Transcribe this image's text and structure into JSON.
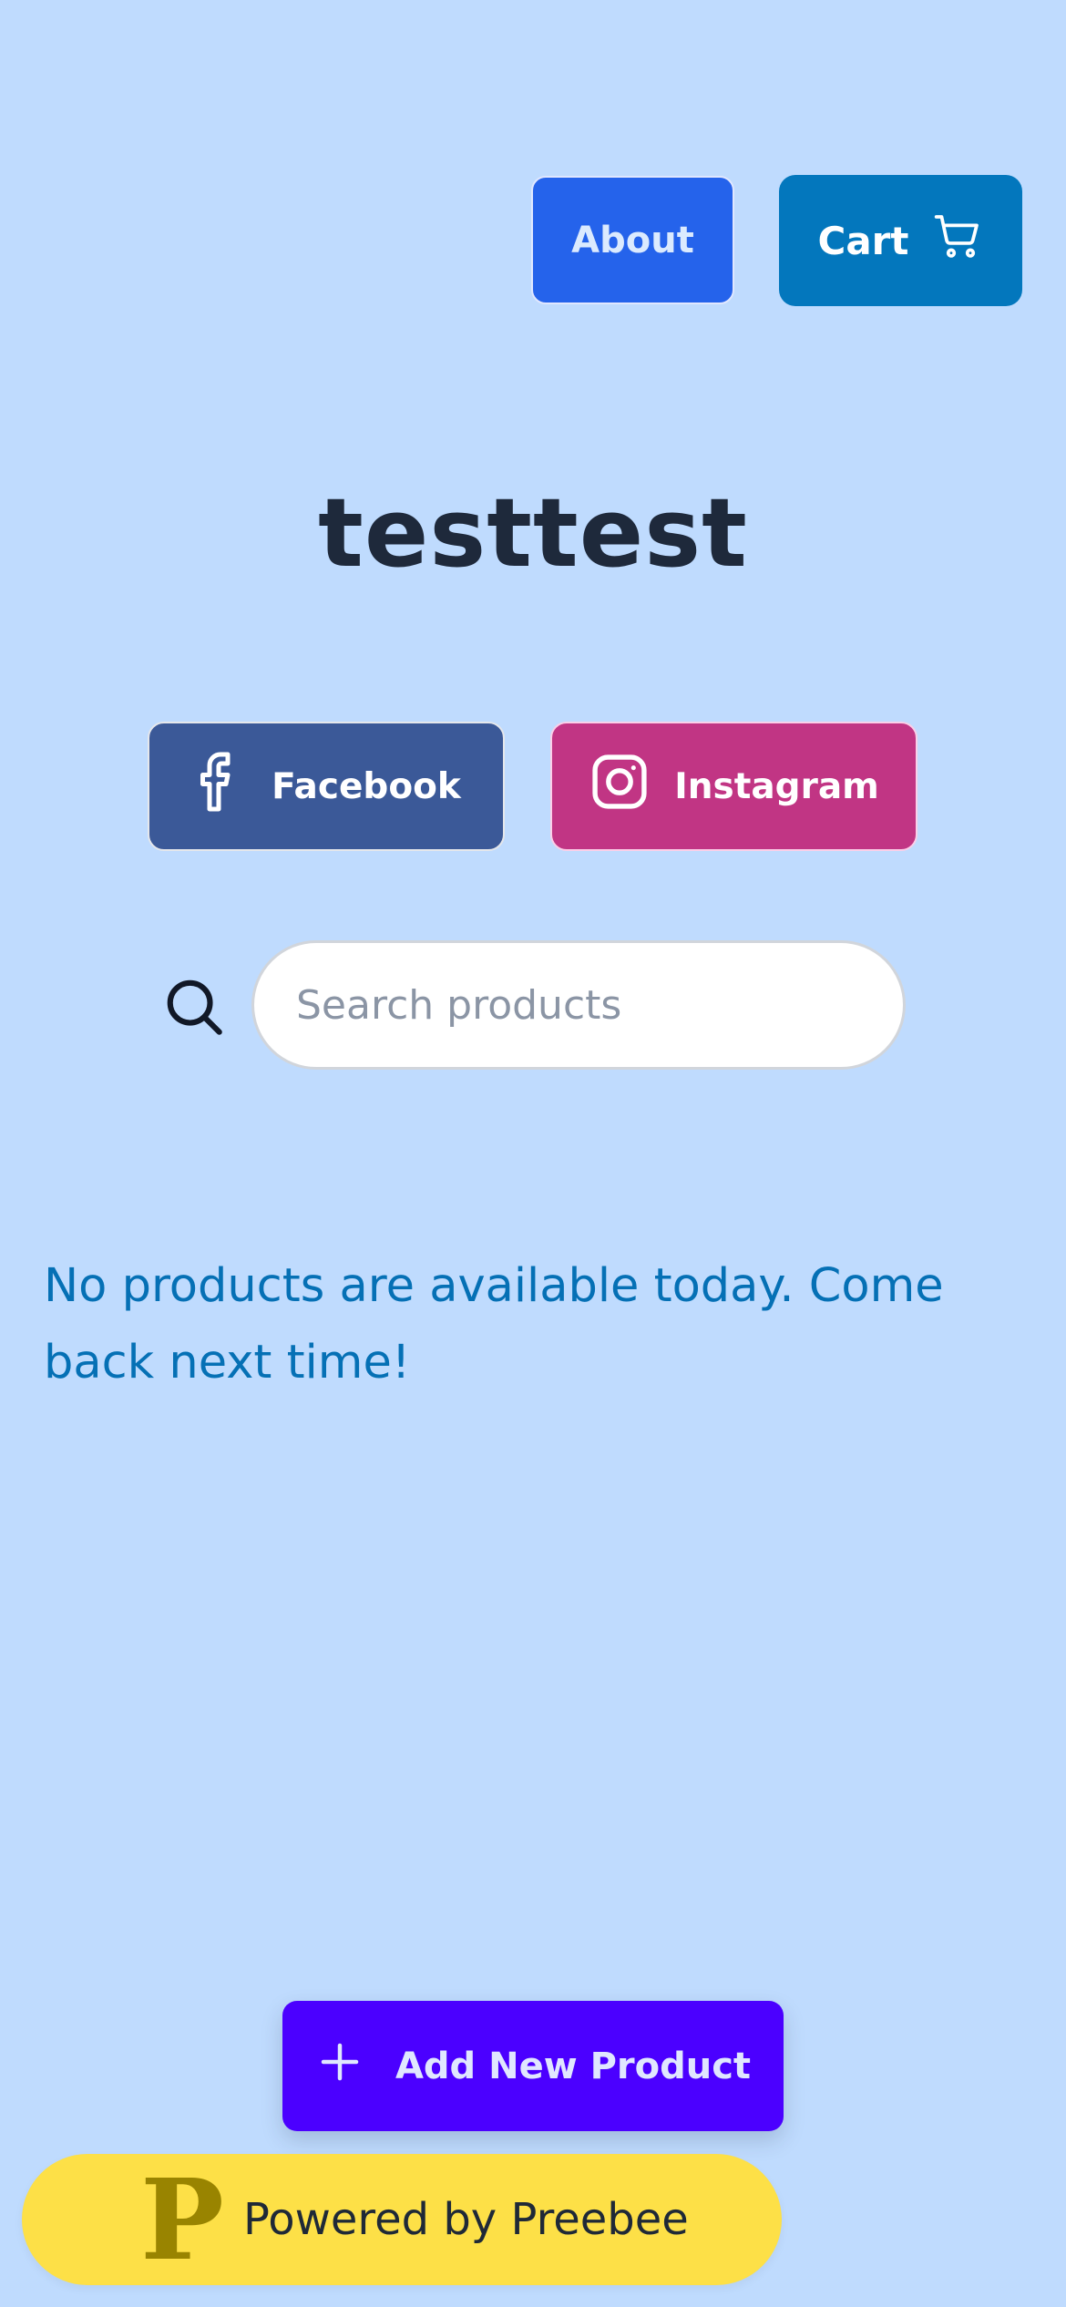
{
  "header": {
    "about_label": "About",
    "cart_label": "Cart",
    "cart_icon": "shopping-cart-icon"
  },
  "store": {
    "title": "testtest"
  },
  "social": {
    "facebook_label": "Facebook",
    "facebook_icon": "facebook-icon",
    "instagram_label": "Instagram",
    "instagram_icon": "instagram-icon"
  },
  "search": {
    "placeholder": "Search products",
    "value": "",
    "icon": "search-icon"
  },
  "products": {
    "empty_message": "No products are available today. Come back next time!"
  },
  "actions": {
    "add_product_label": "Add New Product",
    "add_icon": "plus-icon"
  },
  "footer": {
    "logo_letter": "P",
    "powered_text": "Powered by Preebee"
  },
  "colors": {
    "background": "#bfdbfe",
    "about_button": "#2563eb",
    "cart_button": "#0377bd",
    "facebook": "#3b5998",
    "instagram": "#c13584",
    "add_button": "#4b00ff",
    "powered_badge": "#fde047"
  }
}
